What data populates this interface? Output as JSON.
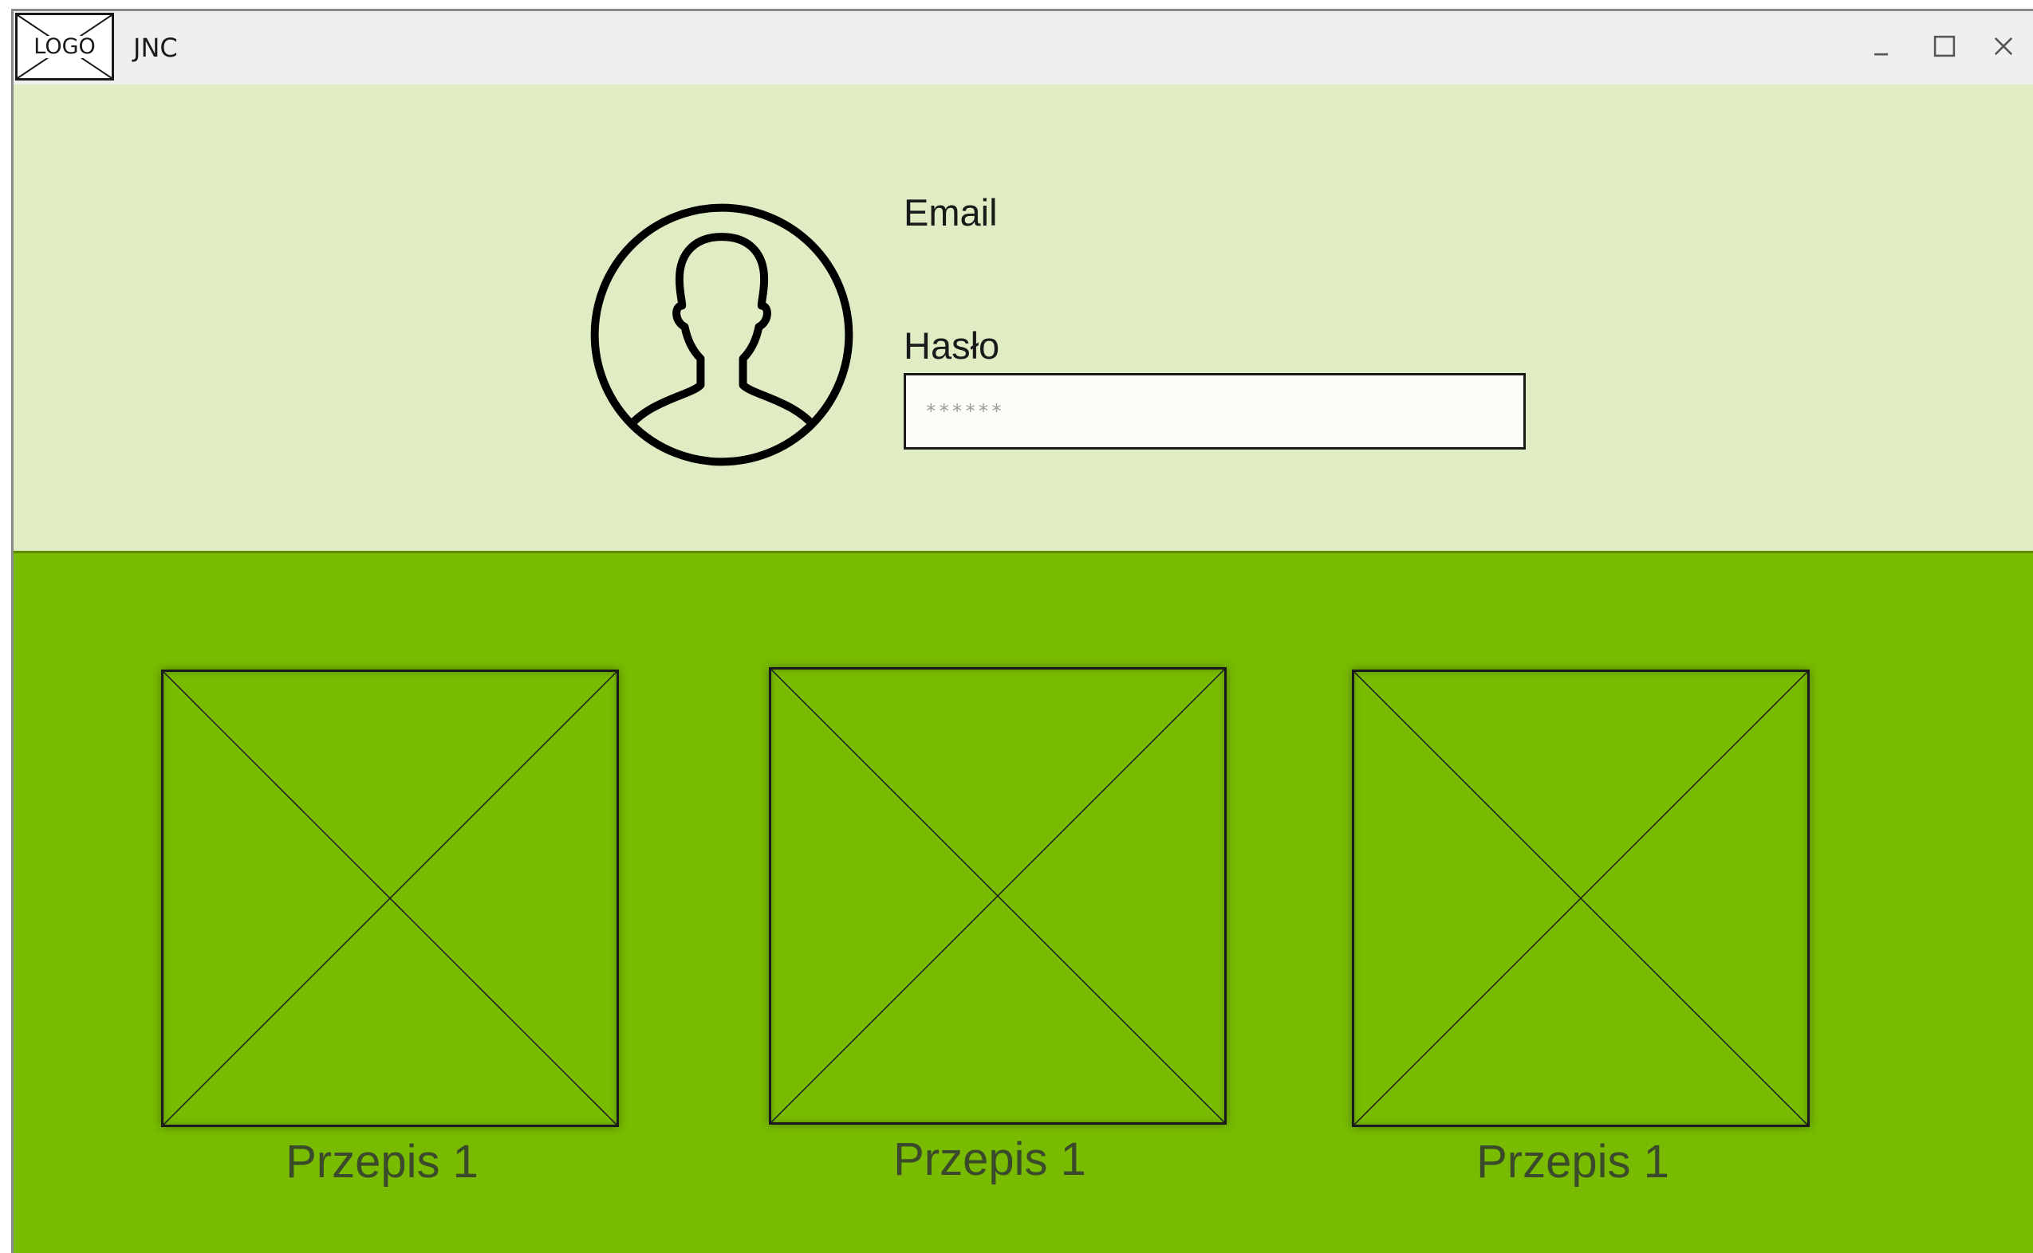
{
  "titlebar": {
    "logo_text": "LOGO",
    "title": "JNC",
    "controls": {
      "minimize_icon": "minimize-icon",
      "maximize_icon": "maximize-icon",
      "close_icon": "close-icon"
    }
  },
  "login": {
    "avatar_icon": "user-avatar-icon",
    "email_label": "Email",
    "password_label": "Hasło",
    "password_placeholder": "******"
  },
  "recipes": [
    {
      "label": "Przepis 1",
      "image_icon": "image-placeholder-icon"
    },
    {
      "label": "Przepis 1",
      "image_icon": "image-placeholder-icon"
    },
    {
      "label": "Przepis 1",
      "image_icon": "image-placeholder-icon"
    }
  ],
  "colors": {
    "titlebar_bg": "#efefef",
    "top_section_bg": "#dfecc4",
    "bottom_section_bg": "#78bb00",
    "border": "#1a1a1a"
  }
}
